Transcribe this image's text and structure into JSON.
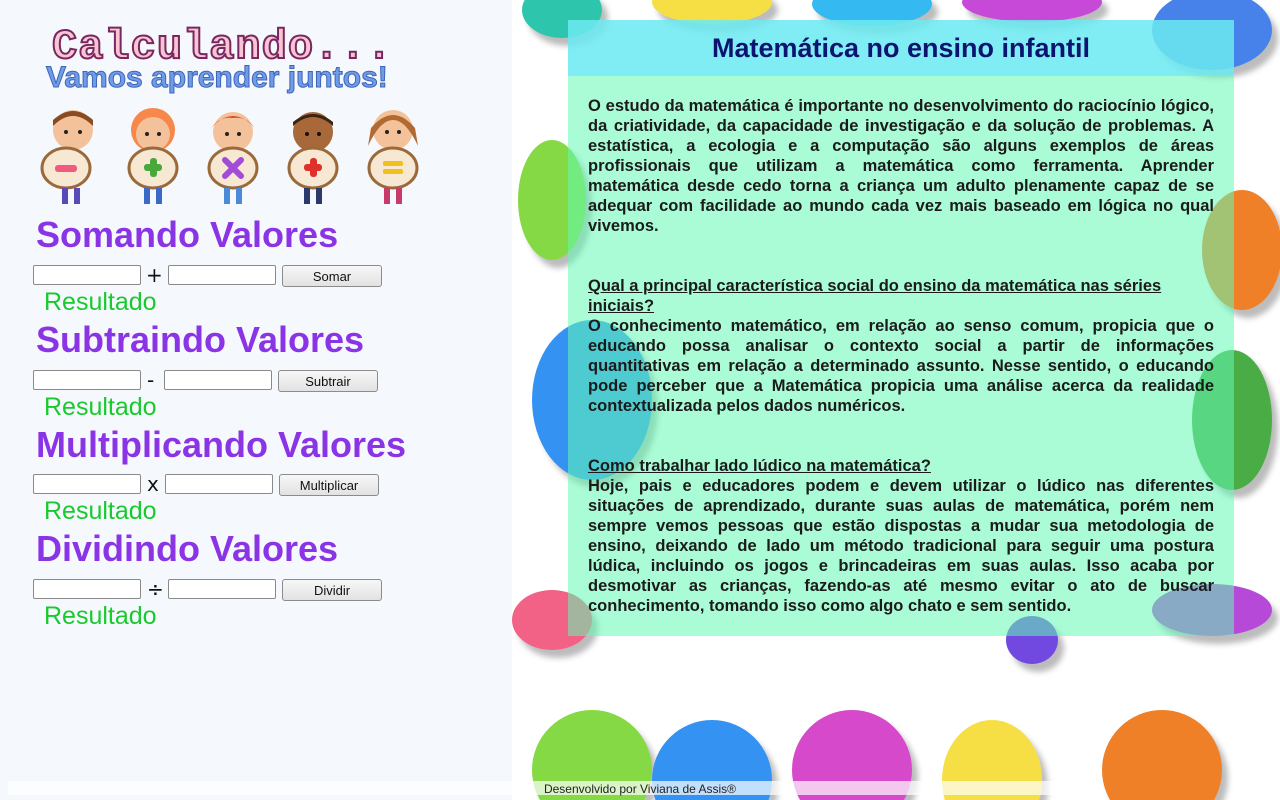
{
  "header": {
    "logo_title": "Calculando...",
    "logo_subtitle": "Vamos aprender juntos!"
  },
  "kids_icons": [
    "minus-icon",
    "plus-icon",
    "times-icon",
    "plus-icon",
    "divide-icon"
  ],
  "calculators": {
    "add": {
      "title": "Somando Valores",
      "operator": "+",
      "button": "Somar",
      "result": "Resultado"
    },
    "subtract": {
      "title": "Subtraindo Valores",
      "operator": "-",
      "button": "Subtrair",
      "result": "Resultado"
    },
    "multiply": {
      "title": "Multiplicando Valores",
      "operator": "x",
      "button": "Multiplicar",
      "result": "Resultado"
    },
    "divide": {
      "title": "Dividindo Valores",
      "operator": "÷",
      "button": "Dividir",
      "result": "Resultado"
    }
  },
  "article": {
    "title": "Matemática no ensino infantil",
    "intro": "O estudo da matemática é importante no desenvolvimento do raciocínio lógico, da criatividade, da capacidade de investigação e da solução de problemas. A estatística, a ecologia e a computação são alguns exemplos de áreas profissionais que utilizam a matemática como ferramenta. Aprender matemática desde cedo torna a criança um adulto plenamente capaz de se adequar com facilidade ao mundo cada vez mais baseado em lógica no qual vivemos.",
    "q1": "Qual a principal característica social do ensino da matemática nas séries iniciais?",
    "a1": "O conhecimento matemático, em relação ao senso comum, propicia que o educando possa analisar o contexto social a partir de informações quantitativas em relação a determinado assunto. Nesse sentido, o educando pode perceber que a Matemática propicia uma análise acerca da realidade contextualizada pelos dados numéricos.",
    "q2": "Como trabalhar lado lúdico na matemática?",
    "a2": "Hoje, pais e educadores podem e devem utilizar o lúdico nas diferentes situações de aprendizado, durante suas aulas de matemática, porém nem sempre vemos pessoas que estão dispostas a mudar sua metodologia de ensino, deixando de lado um método tradicional para seguir uma postura lúdica, incluindo os jogos e brincadeiras em suas aulas. Isso acaba por desmotivar as crianças, fazendo-as até mesmo evitar o ato de buscar conhecimento, tomando isso como algo chato e sem sentido."
  },
  "footer": {
    "credit": "Desenvolvido por Viviana de Assis®"
  },
  "colors": {
    "section_title": "#8a34e6",
    "result": "#19c92e",
    "article_title": "#0b1470"
  }
}
